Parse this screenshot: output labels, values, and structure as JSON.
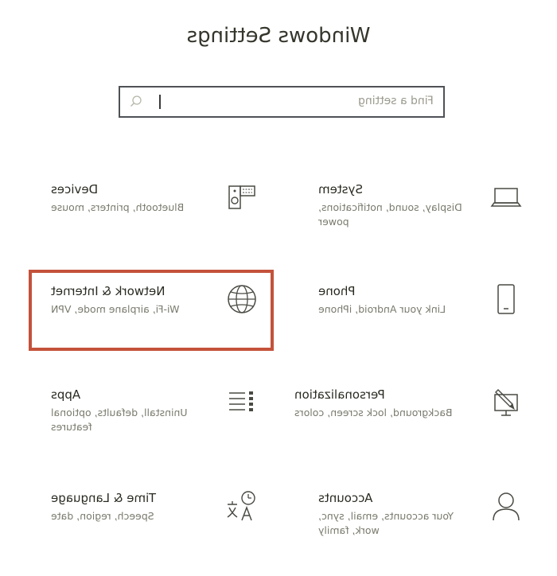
{
  "window": {
    "title": "Windows Settings"
  },
  "search": {
    "placeholder": "Find a setting"
  },
  "tiles": [
    {
      "id": "system",
      "title": "System",
      "description": "Display, sound, notifications,\npower",
      "icon": "laptop-icon"
    },
    {
      "id": "devices",
      "title": "Devices",
      "description": "Bluetooth, printers, mouse",
      "icon": "devices-icon"
    },
    {
      "id": "phone",
      "title": "Phone",
      "description": "Link your Android, iPhone",
      "icon": "phone-icon"
    },
    {
      "id": "network",
      "title": "Network & Internet",
      "description": "Wi-Fi, airplane mode, VPN",
      "icon": "globe-icon",
      "highlighted": true
    },
    {
      "id": "personalization",
      "title": "Personalization",
      "description": "Background, lock screen, colors",
      "icon": "paintbrush-icon"
    },
    {
      "id": "apps",
      "title": "Apps",
      "description": "Uninstall, defaults, optional\nfeatures",
      "icon": "apps-list-icon"
    },
    {
      "id": "accounts",
      "title": "Accounts",
      "description": "Your accounts, email, sync,\nwork, family",
      "icon": "person-icon"
    },
    {
      "id": "time-language",
      "title": "Time & Language",
      "description": "Speech, region, date",
      "icon": "time-language-icon"
    }
  ],
  "colors": {
    "highlight": "#c4523b",
    "search_border": "#4e5256",
    "icon_stroke": "#4a4a44"
  }
}
